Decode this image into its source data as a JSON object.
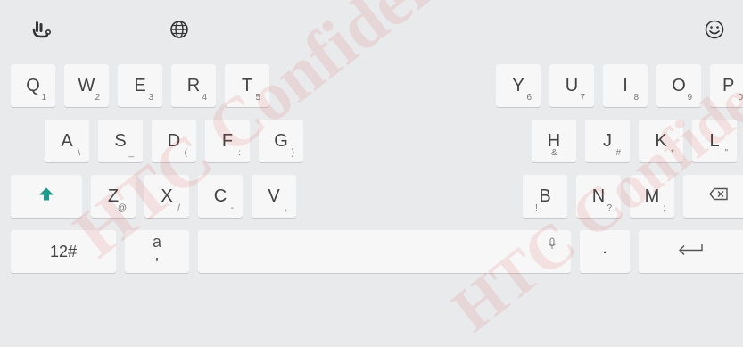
{
  "toolbar": {
    "left_icon": "handwriting-icon",
    "globe_icon": "globe-icon",
    "emoji_icon": "emoji-icon"
  },
  "rows": {
    "row1_left": [
      {
        "label": "Q",
        "sub": "1"
      },
      {
        "label": "W",
        "sub": "2"
      },
      {
        "label": "E",
        "sub": "3"
      },
      {
        "label": "R",
        "sub": "4"
      },
      {
        "label": "T",
        "sub": "5"
      }
    ],
    "row1_right": [
      {
        "label": "Y",
        "sub": "6"
      },
      {
        "label": "U",
        "sub": "7"
      },
      {
        "label": "I",
        "sub": "8"
      },
      {
        "label": "O",
        "sub": "9"
      },
      {
        "label": "P",
        "sub": "0"
      }
    ],
    "row2_left": [
      {
        "label": "A",
        "sub": "\\"
      },
      {
        "label": "S",
        "sub": "_"
      },
      {
        "label": "D",
        "sub": "("
      },
      {
        "label": "F",
        "sub": ":"
      },
      {
        "label": "G",
        "sub": ")"
      }
    ],
    "row2_right": [
      {
        "label": "H",
        "sub": "&"
      },
      {
        "label": "J",
        "sub": "#"
      },
      {
        "label": "K",
        "sub": "*"
      },
      {
        "label": "L",
        "sub": "\""
      }
    ],
    "row3_left": [
      {
        "label": "Z",
        "sub": "@"
      },
      {
        "label": "X",
        "sub": "/"
      },
      {
        "label": "C",
        "sub": "-"
      },
      {
        "label": "V",
        "sub": ","
      }
    ],
    "row3_right": [
      {
        "label": "B",
        "sub": "!"
      },
      {
        "label": "N",
        "sub": "?"
      },
      {
        "label": "M",
        "sub": ";"
      }
    ]
  },
  "bottom": {
    "numbers_label": "12#",
    "lang_key_top": "a",
    "lang_key_bottom": ",",
    "period_label": "."
  },
  "watermark": "HTC Confidential",
  "colors": {
    "accent": "#1c9a8c",
    "background": "#e9eaec",
    "key": "#f7f7f8"
  }
}
